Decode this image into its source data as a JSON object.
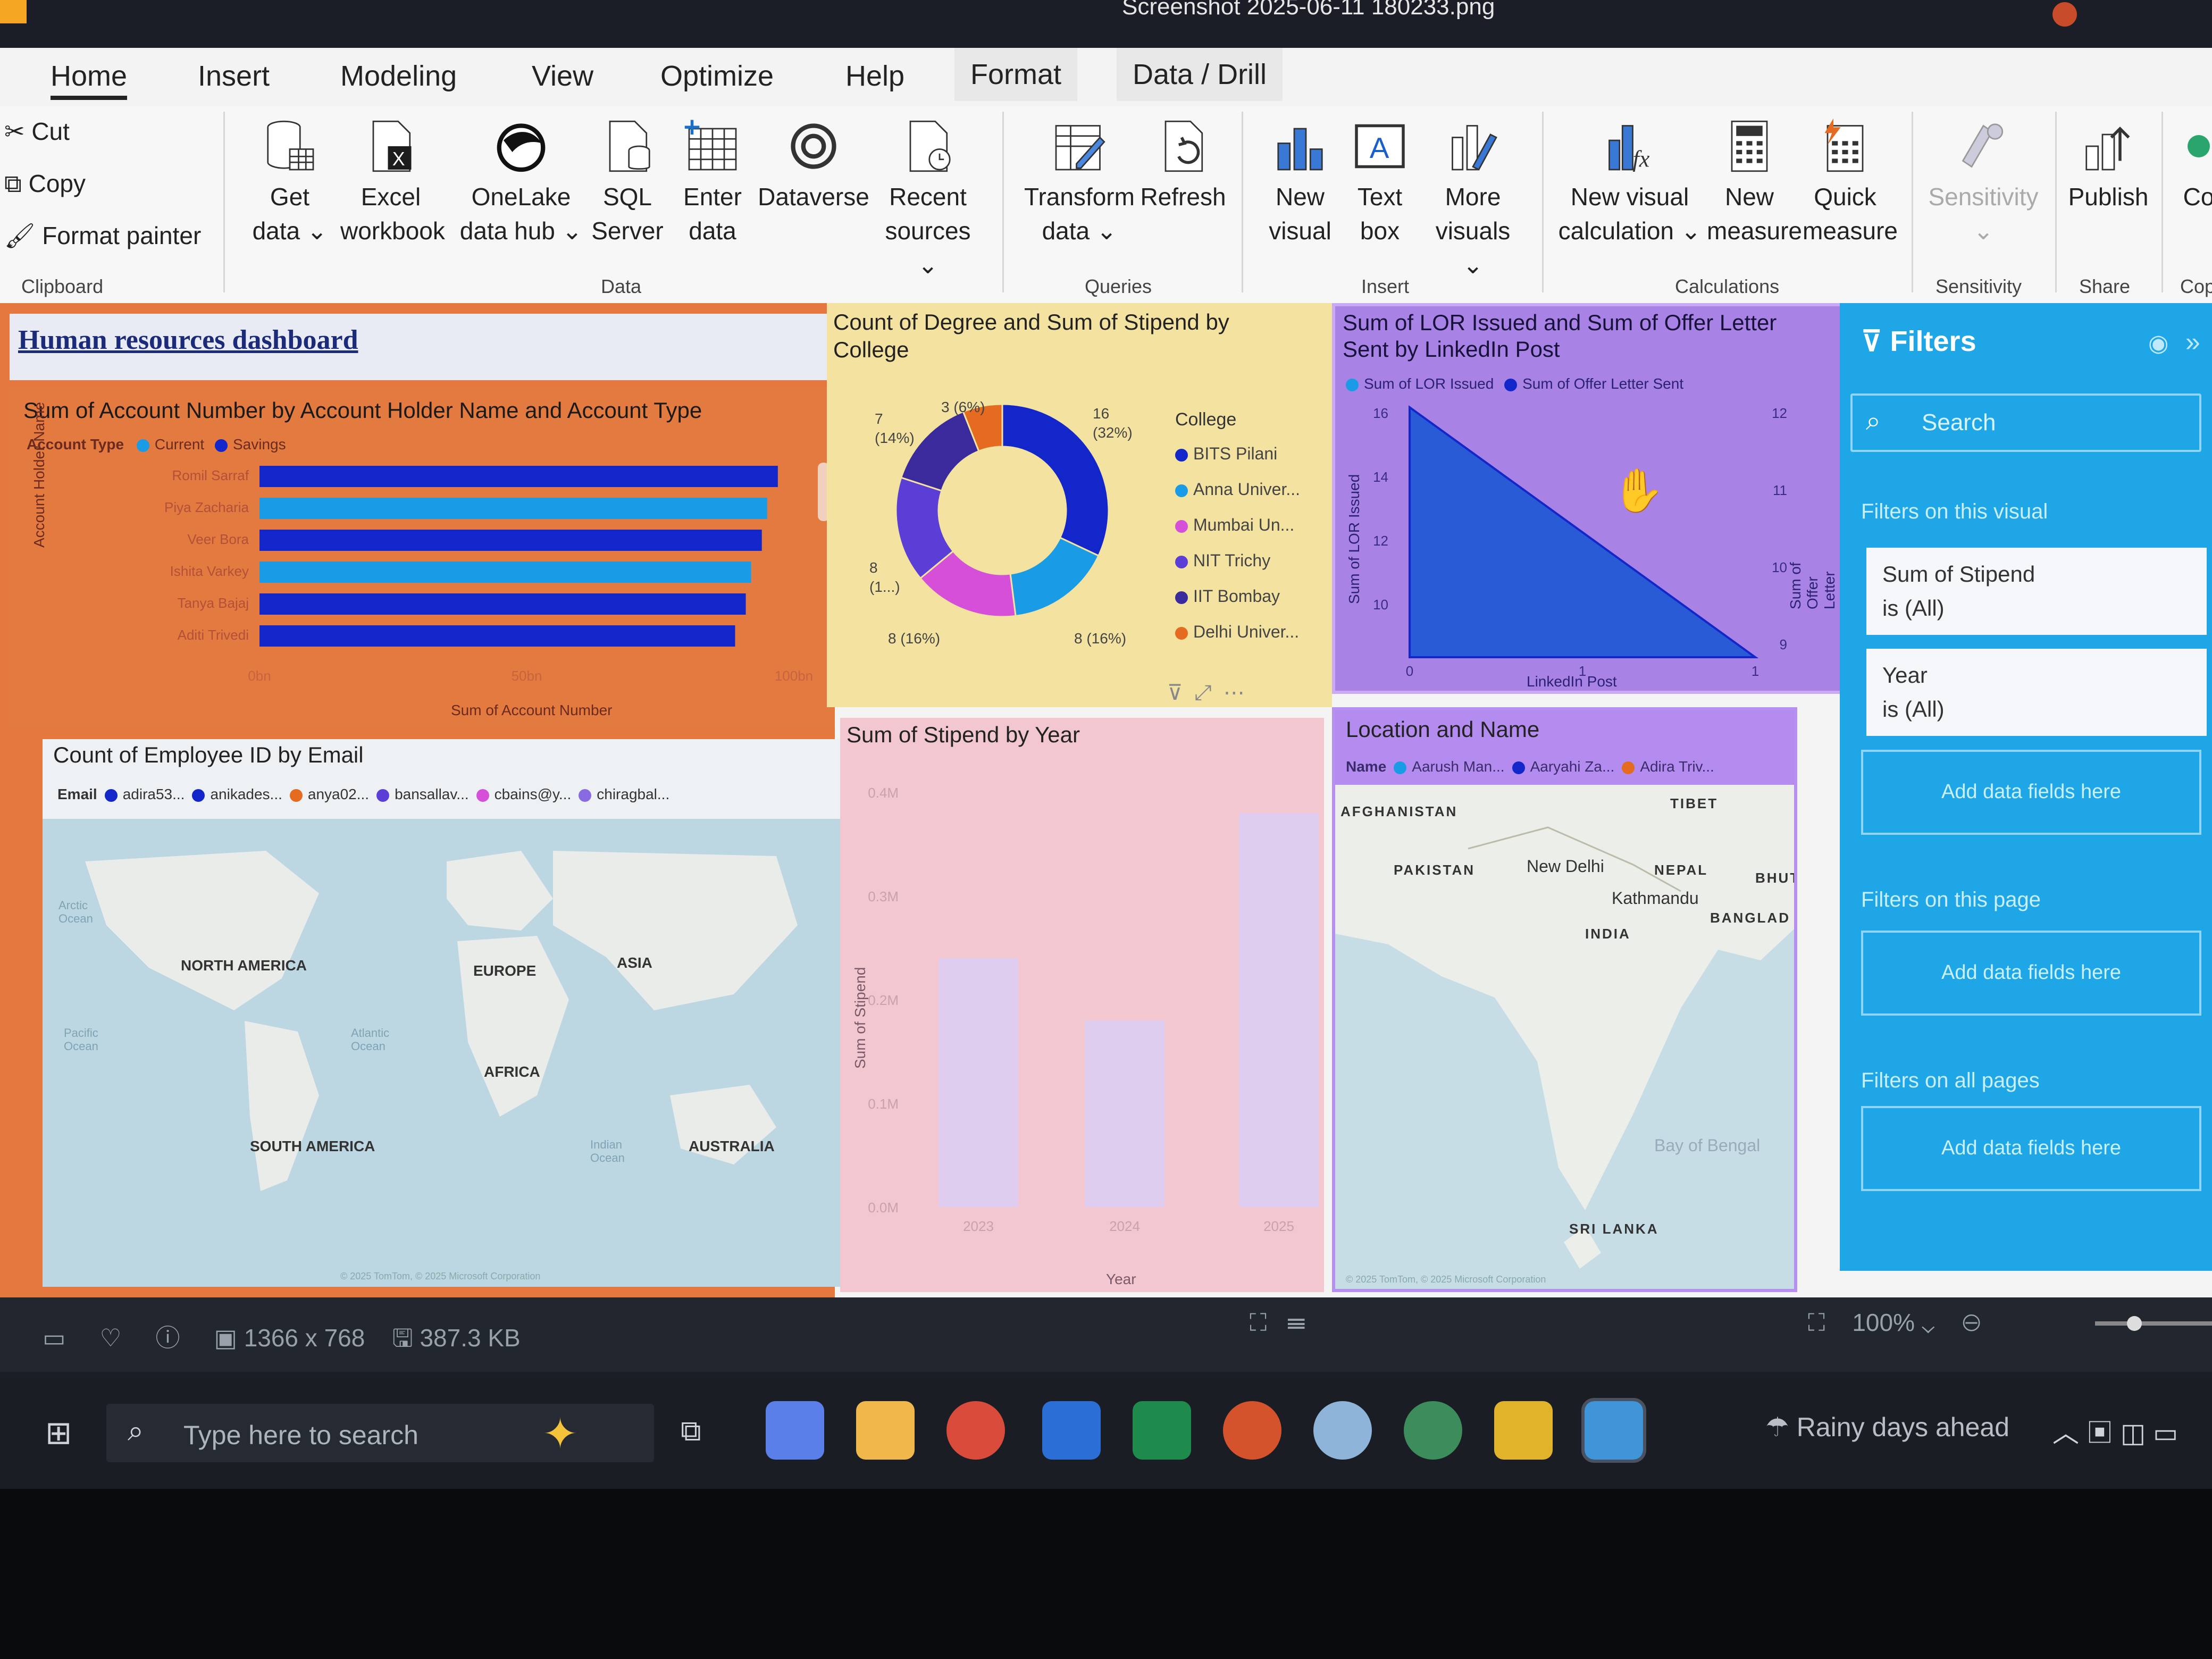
{
  "window": {
    "title": "Screenshot 2025-06-11 180233.png"
  },
  "menu_tabs": [
    "Home",
    "Insert",
    "Modeling",
    "View",
    "Optimize",
    "Help",
    "Format",
    "Data / Drill"
  ],
  "ribbon": {
    "clipboard": {
      "cut": "Cut",
      "copy": "Copy",
      "format_painter": "Format painter",
      "group": "Clipboard"
    },
    "data": {
      "get_data": [
        "Get",
        "data"
      ],
      "excel": [
        "Excel",
        "workbook"
      ],
      "onelake": [
        "OneLake",
        "data hub"
      ],
      "sql": [
        "SQL",
        "Server"
      ],
      "enter": [
        "Enter",
        "data"
      ],
      "dataverse": [
        "Dataverse",
        ""
      ],
      "recent": [
        "Recent",
        "sources"
      ],
      "group": "Data"
    },
    "queries": {
      "transform": [
        "Transform",
        "data"
      ],
      "refresh": [
        "Refresh",
        ""
      ],
      "group": "Queries"
    },
    "insert": {
      "new_visual": [
        "New",
        "visual"
      ],
      "text_box": [
        "Text",
        "box"
      ],
      "more_visuals": [
        "More",
        "visuals"
      ],
      "group": "Insert"
    },
    "calculations": {
      "new_visual_calc": [
        "New visual",
        "calculation"
      ],
      "new_measure": [
        "New",
        "measure"
      ],
      "quick_measure": [
        "Quick",
        "measure"
      ],
      "group": "Calculations"
    },
    "sensitivity": {
      "label": "Sensitivity",
      "group": "Sensitivity"
    },
    "share": {
      "publish": "Publish",
      "group": "Share"
    },
    "copilot": {
      "label": "Co",
      "group": "Cop"
    }
  },
  "dashboard": {
    "title": "Human resources dashboard",
    "bar_visual": {
      "title": "Sum of Account Number by Account Holder Name and Account Type",
      "legend_title": "Account Type",
      "legend": [
        "Current",
        "Savings"
      ],
      "ylabel": "Account Holder Name",
      "xlabel": "Sum of Account Number",
      "xticks": [
        "0bn",
        "50bn",
        "100bn"
      ]
    },
    "donut_visual": {
      "title": [
        "Count of Degree and Sum of Stipend by",
        "College"
      ],
      "legend_title": "College",
      "legend": [
        "BITS Pilani",
        "Anna Univer...",
        "Mumbai Un...",
        "NIT Trichy",
        "IIT Bombay",
        "Delhi Univer..."
      ],
      "labels": [
        "16",
        "(32%)",
        "8 (16%)",
        "8 (16%)",
        "8",
        "(1...)",
        "7",
        "(14%)",
        "3 (6%)"
      ]
    },
    "area_visual": {
      "title": [
        "Sum of LOR Issued and Sum of Offer Letter",
        "Sent by LinkedIn Post"
      ],
      "legend": [
        "Sum of LOR Issued",
        "Sum of Offer Letter Sent"
      ],
      "y_left_label": "Sum of LOR Issued",
      "y_right_label": "Sum of Offer Letter Sent",
      "xlabel": "LinkedIn Post",
      "y_left_ticks": [
        "16",
        "14",
        "12",
        "10"
      ],
      "y_right_ticks": [
        "12",
        "11",
        "10",
        "9"
      ],
      "xticks": [
        "0",
        "1",
        "1"
      ]
    },
    "map_visual": {
      "title": "Count of Employee ID by Email",
      "legend_title": "Email",
      "legend": [
        "adira53...",
        "anikades...",
        "anya02...",
        "bansallav...",
        "cbains@y...",
        "chiragbal..."
      ],
      "labels": [
        "Arctic",
        "Ocean",
        "NORTH AMERICA",
        "EUROPE",
        "ASIA",
        "Pacific",
        "Ocean",
        "Atlantic",
        "Ocean",
        "AFRICA",
        "SOUTH AMERICA",
        "Indian",
        "Ocean",
        "AUSTRALIA"
      ],
      "attribution": "© 2025 TomTom, © 2025 Microsoft Corporation"
    },
    "stipend_visual": {
      "title": "Sum of Stipend by Year",
      "ylabel": "Sum of Stipend",
      "xlabel": "Year",
      "yticks": [
        "0.4M",
        "0.3M",
        "0.2M",
        "0.1M",
        "0.0M"
      ],
      "xticks": [
        "2023",
        "2024",
        "2025"
      ]
    },
    "india_map_visual": {
      "title": "Location and Name",
      "legend_title": "Name",
      "legend": [
        "Aarush Man...",
        "Aaryahi Za...",
        "Adira Triv..."
      ],
      "labels": [
        "AFGHANISTAN",
        "PAKISTAN",
        "New Delhi",
        "NEPAL",
        "Kathmandu",
        "BHUT",
        "BANGLAD",
        "INDIA",
        "TIBET",
        "SRI LANKA",
        "Bay of Bengal"
      ],
      "attribution": "© 2025 TomTom, © 2025 Microsoft Corporation"
    }
  },
  "chart_data": [
    {
      "type": "bar",
      "title": "Sum of Account Number by Account Holder Name and Account Type",
      "categories": [
        "Romil Sarraf",
        "Piya Zacharia",
        "Veer Bora",
        "Ishita Varkey",
        "Tanya Bajaj",
        "Aditi Trivedi"
      ],
      "series": [
        {
          "name": "Current",
          "values": [
            null,
            95,
            null,
            92,
            null,
            null
          ]
        },
        {
          "name": "Savings",
          "values": [
            97,
            null,
            94,
            null,
            91,
            89
          ]
        }
      ],
      "xlabel": "Sum of Account Number",
      "ylabel": "Account Holder Name",
      "xlim": [
        0,
        100
      ],
      "legend": "top-left"
    },
    {
      "type": "pie",
      "title": "Count of Degree and Sum of Stipend by College",
      "categories": [
        "BITS Pilani",
        "Anna Univer...",
        "Mumbai Un...",
        "NIT Trichy",
        "IIT Bombay",
        "Delhi Univer..."
      ],
      "values": [
        16,
        8,
        8,
        8,
        7,
        3
      ]
    },
    {
      "type": "area",
      "title": "Sum of LOR Issued and Sum of Offer Letter Sent by LinkedIn Post",
      "x": [
        0,
        1
      ],
      "series": [
        {
          "name": "Sum of LOR Issued",
          "values": [
            16,
            9
          ]
        }
      ],
      "xlabel": "LinkedIn Post",
      "ylabel": "Sum of LOR Issued"
    },
    {
      "type": "bar",
      "title": "Sum of Stipend by Year",
      "categories": [
        "2023",
        "2024",
        "2025"
      ],
      "values": [
        0.24,
        0.18,
        0.38
      ],
      "ylabel": "Sum of Stipend",
      "xlabel": "Year",
      "ylim": [
        0,
        0.4
      ]
    }
  ],
  "filters": {
    "title": "Filters",
    "search_placeholder": "Search",
    "on_visual": "Filters on this visual",
    "cards": [
      [
        "Sum of Stipend",
        "is (All)"
      ],
      [
        "Year",
        "is (All)"
      ]
    ],
    "add_fields": "Add data fields here",
    "on_page": "Filters on this page",
    "on_all": "Filters on all pages"
  },
  "status": {
    "resolution": "1366 x 768",
    "size": "387.3 KB",
    "zoom": "100%"
  },
  "taskbar": {
    "search": "Type here to search",
    "weather": "Rainy days ahead"
  },
  "colors": {
    "accent": "#1ea6e6",
    "bar_dark": "#1226c9",
    "bar_light": "#1a9be6",
    "orange_panel": "#e4783e",
    "yellow_panel": "#f4e2a0",
    "purple_panel": "#a982e6",
    "pink_panel": "#f2c7cf"
  }
}
